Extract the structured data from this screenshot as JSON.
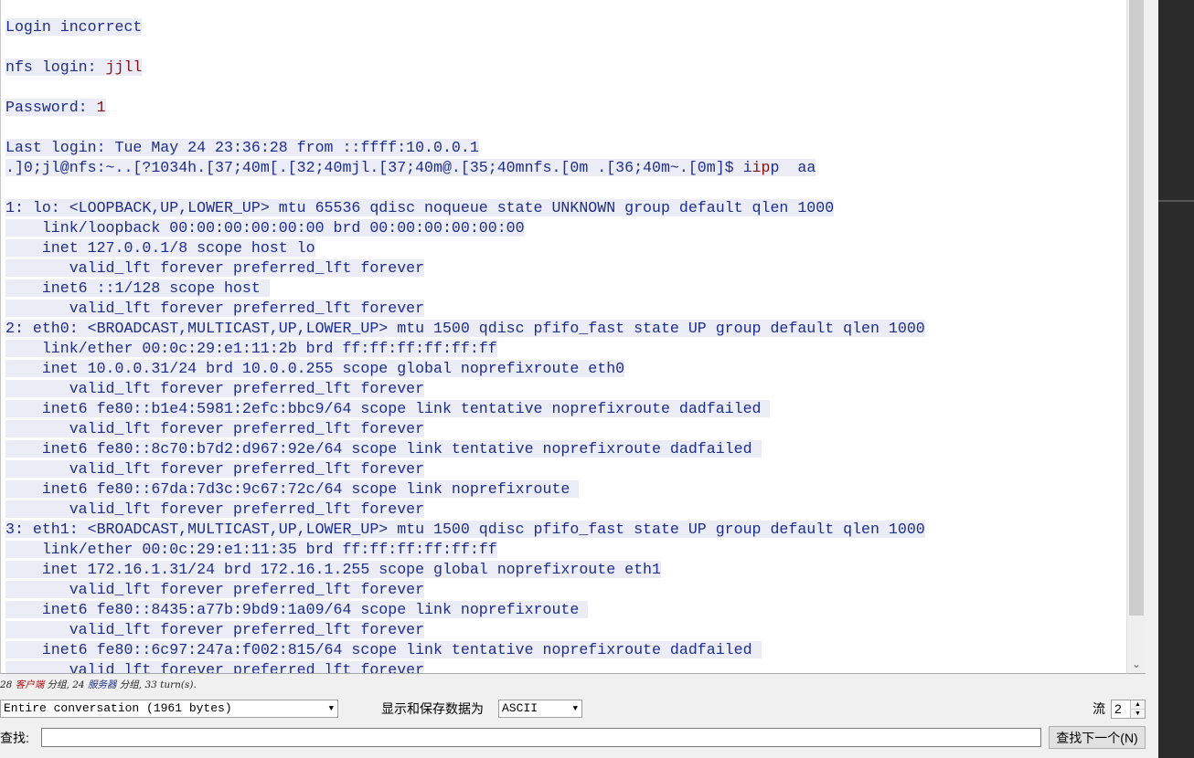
{
  "stream_lines": [
    {
      "text": "",
      "dir": "none"
    },
    {
      "text": "Login incorrect",
      "dir": "client"
    },
    {
      "text": "",
      "dir": "none"
    },
    {
      "text": "nfs login: ",
      "dir": "client",
      "suffix": "jjll"
    },
    {
      "text": "",
      "dir": "none"
    },
    {
      "text": "Password: ",
      "dir": "client",
      "suffix": "1"
    },
    {
      "text": "",
      "dir": "none"
    },
    {
      "text": "Last login: Tue May 24 23:36:28 from ::ffff:10.0.0.1",
      "dir": "client"
    },
    {
      "text": ".]0;jl@nfs:~..[?1034h.[37;40m[.[32;40mjl.[37;40m@.[35;40mnfs.[0m .[36;40m~.[0m]$ i",
      "dir": "client",
      "suffix": "ip",
      "tail": "p  a",
      "tail2": "a"
    },
    {
      "text": "",
      "dir": "none"
    },
    {
      "text": "1: lo: <LOOPBACK,UP,LOWER_UP> mtu 65536 qdisc noqueue state UNKNOWN group default qlen 1000",
      "dir": "client"
    },
    {
      "text": "    link/loopback 00:00:00:00:00:00 brd 00:00:00:00:00:00",
      "dir": "client"
    },
    {
      "text": "    inet 127.0.0.1/8 scope host lo",
      "dir": "client"
    },
    {
      "text": "       valid_lft forever preferred_lft forever",
      "dir": "client"
    },
    {
      "text": "    inet6 ::1/128 scope host ",
      "dir": "client"
    },
    {
      "text": "       valid_lft forever preferred_lft forever",
      "dir": "client"
    },
    {
      "text": "2: eth0: <BROADCAST,MULTICAST,UP,LOWER_UP> mtu 1500 qdisc pfifo_fast state UP group default qlen 1000",
      "dir": "client"
    },
    {
      "text": "    link/ether 00:0c:29:e1:11:2b brd ff:ff:ff:ff:ff:ff",
      "dir": "client"
    },
    {
      "text": "    inet 10.0.0.31/24 brd 10.0.0.255 scope global noprefixroute eth0",
      "dir": "client"
    },
    {
      "text": "       valid_lft forever preferred_lft forever",
      "dir": "client"
    },
    {
      "text": "    inet6 fe80::b1e4:5981:2efc:bbc9/64 scope link tentative noprefixroute dadfailed ",
      "dir": "client"
    },
    {
      "text": "       valid_lft forever preferred_lft forever",
      "dir": "client"
    },
    {
      "text": "    inet6 fe80::8c70:b7d2:d967:92e/64 scope link tentative noprefixroute dadfailed ",
      "dir": "client"
    },
    {
      "text": "       valid_lft forever preferred_lft forever",
      "dir": "client"
    },
    {
      "text": "    inet6 fe80::67da:7d3c:9c67:72c/64 scope link noprefixroute ",
      "dir": "client"
    },
    {
      "text": "       valid_lft forever preferred_lft forever",
      "dir": "client"
    },
    {
      "text": "3: eth1: <BROADCAST,MULTICAST,UP,LOWER_UP> mtu 1500 qdisc pfifo_fast state UP group default qlen 1000",
      "dir": "client"
    },
    {
      "text": "    link/ether 00:0c:29:e1:11:35 brd ff:ff:ff:ff:ff:ff",
      "dir": "client"
    },
    {
      "text": "    inet 172.16.1.31/24 brd 172.16.1.255 scope global noprefixroute eth1",
      "dir": "client"
    },
    {
      "text": "       valid_lft forever preferred_lft forever",
      "dir": "client"
    },
    {
      "text": "    inet6 fe80::8435:a77b:9bd9:1a09/64 scope link noprefixroute ",
      "dir": "client"
    },
    {
      "text": "       valid_lft forever preferred_lft forever",
      "dir": "client"
    },
    {
      "text": "    inet6 fe80::6c97:247a:f002:815/64 scope link tentative noprefixroute dadfailed ",
      "dir": "client"
    },
    {
      "text": "       valid_lft forever preferred_lft forever",
      "dir": "client"
    }
  ],
  "status": {
    "client_count": "28",
    "client_label": "客户端",
    "mid1": " 分组, ",
    "server_count": "24",
    "server_label": "服务器",
    "mid2": " 分组, ",
    "turns": "33 turn(s)."
  },
  "controls": {
    "conversation_option": "Entire conversation (1961 bytes)",
    "format_label": "显示和保存数据为",
    "format_option": "ASCII",
    "stream_label": "流",
    "stream_value": "2",
    "find_label": "查找:",
    "find_value": "",
    "find_next_label": "查找下一个(N)"
  },
  "colors": {
    "client_text": "#1c2e8a",
    "server_text": "#8a1010",
    "line_highlight": "#ececf6"
  },
  "icons": {
    "dropdown": "▼",
    "scroll_down": "chevron-down",
    "spin_up": "▲",
    "spin_down": "▼"
  }
}
